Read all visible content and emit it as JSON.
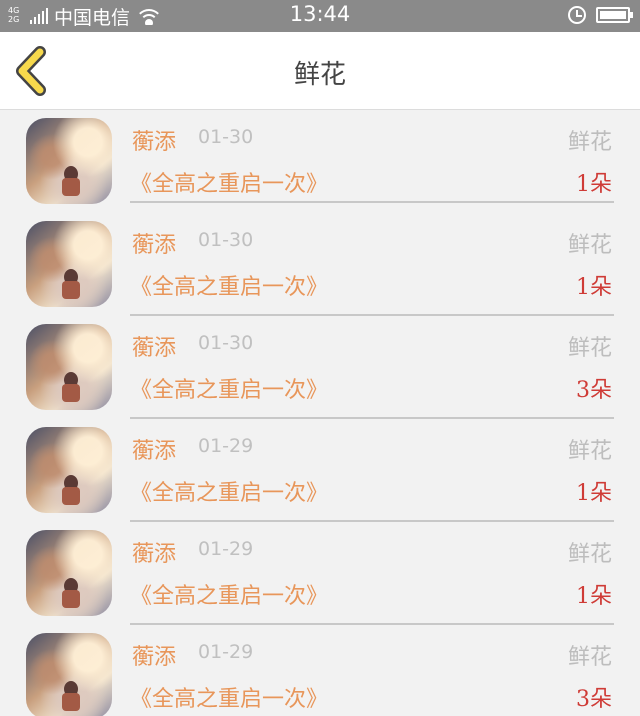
{
  "status_bar": {
    "network": "4G",
    "network2": "2G",
    "carrier": "中国电信",
    "time": "13:44"
  },
  "header": {
    "title": "鲜花"
  },
  "colors": {
    "accent_orange": "#e8965a",
    "count_red": "#cf3b36",
    "back_yellow": "#f7d94c"
  },
  "rows": [
    {
      "user": "蘅添",
      "date": "01-30",
      "gift": "鲜花",
      "book": "《全高之重启一次》",
      "count": "1朵"
    },
    {
      "user": "蘅添",
      "date": "01-30",
      "gift": "鲜花",
      "book": "《全高之重启一次》",
      "count": "1朵"
    },
    {
      "user": "蘅添",
      "date": "01-30",
      "gift": "鲜花",
      "book": "《全高之重启一次》",
      "count": "3朵"
    },
    {
      "user": "蘅添",
      "date": "01-29",
      "gift": "鲜花",
      "book": "《全高之重启一次》",
      "count": "1朵"
    },
    {
      "user": "蘅添",
      "date": "01-29",
      "gift": "鲜花",
      "book": "《全高之重启一次》",
      "count": "1朵"
    },
    {
      "user": "蘅添",
      "date": "01-29",
      "gift": "鲜花",
      "book": "《全高之重启一次》",
      "count": "3朵"
    }
  ]
}
